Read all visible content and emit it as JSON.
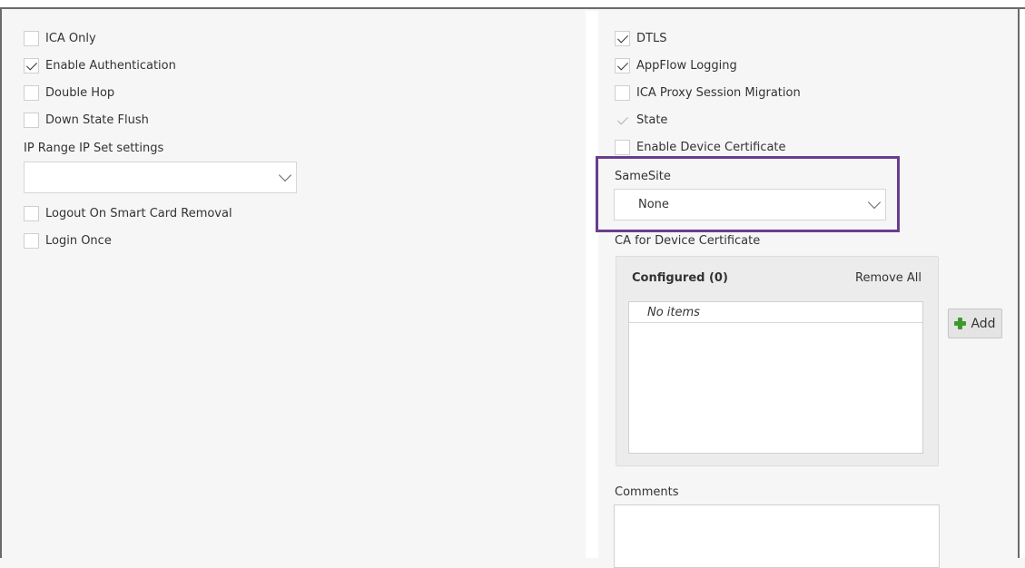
{
  "left": {
    "checkboxes": [
      {
        "label": "ICA Only",
        "checked": false
      },
      {
        "label": "Enable Authentication",
        "checked": true
      },
      {
        "label": "Double Hop",
        "checked": false
      },
      {
        "label": "Down State Flush",
        "checked": false
      }
    ],
    "ip_range_label": "IP Range IP Set settings",
    "ip_range_value": "",
    "checkboxes_after": [
      {
        "label": "Logout On Smart Card Removal",
        "checked": false
      },
      {
        "label": "Login Once",
        "checked": false
      }
    ]
  },
  "right": {
    "checkboxes": [
      {
        "label": "DTLS",
        "checked": true
      },
      {
        "label": "AppFlow Logging",
        "checked": true
      },
      {
        "label": "ICA Proxy Session Migration",
        "checked": false
      },
      {
        "label": "State",
        "checked": true,
        "disabled": true
      },
      {
        "label": "Enable Device Certificate",
        "checked": false
      }
    ],
    "samesite": {
      "label": "SameSite",
      "value": "None"
    },
    "ca_device_cert": {
      "label": "CA for Device Certificate",
      "configured_label": "Configured (0)",
      "remove_all_label": "Remove All",
      "empty_text": "No items",
      "add_label": "Add"
    },
    "comments_label": "Comments"
  },
  "colors": {
    "highlight": "#6a3d8f",
    "add_icon": "#3c9a2c"
  },
  "icons": [
    "checkmark-icon",
    "chevron-down-icon",
    "plus-icon"
  ]
}
